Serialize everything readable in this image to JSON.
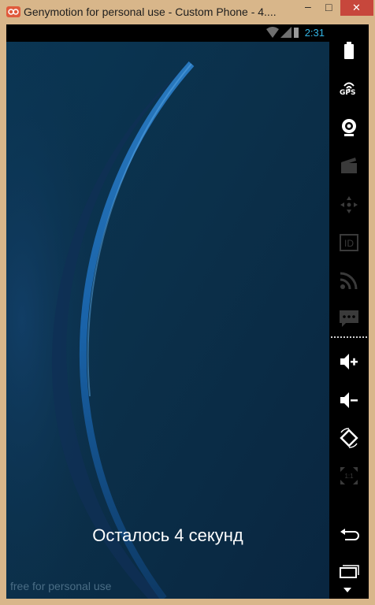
{
  "window": {
    "title": "Genymotion for personal use - Custom Phone - 4....",
    "minimize_glyph": "–",
    "maximize_glyph": "□",
    "close_glyph": "✕"
  },
  "statusbar": {
    "time": "2:31"
  },
  "screen": {
    "countdown_text": "Осталось 4 секунд",
    "watermark": "free for personal use"
  },
  "sidebar": {
    "gps_label": "GPS",
    "id_label": "ID",
    "ratio_label": "1:1",
    "buttons": [
      {
        "name": "battery-icon",
        "enabled": true
      },
      {
        "name": "gps-icon",
        "enabled": true
      },
      {
        "name": "webcam-icon",
        "enabled": true
      },
      {
        "name": "screencast-icon",
        "enabled": false
      },
      {
        "name": "dpad-icon",
        "enabled": false
      },
      {
        "name": "id-icon",
        "enabled": false
      },
      {
        "name": "rss-icon",
        "enabled": false
      },
      {
        "name": "sms-icon",
        "enabled": false
      },
      {
        "name": "volume-up-icon",
        "enabled": true
      },
      {
        "name": "volume-down-icon",
        "enabled": true
      },
      {
        "name": "rotate-icon",
        "enabled": true
      },
      {
        "name": "pixel-perfect-icon",
        "enabled": false
      },
      {
        "name": "back-icon",
        "enabled": true
      },
      {
        "name": "recent-apps-icon",
        "enabled": true
      },
      {
        "name": "scroll-down-icon",
        "enabled": true
      }
    ]
  },
  "colors": {
    "accent": "#33b5e5",
    "wallpaper_dark": "#0a2a40",
    "wallpaper_arc": "#1e6fb3",
    "window_frame": "#d8b68a",
    "close_button": "#c7473c"
  }
}
